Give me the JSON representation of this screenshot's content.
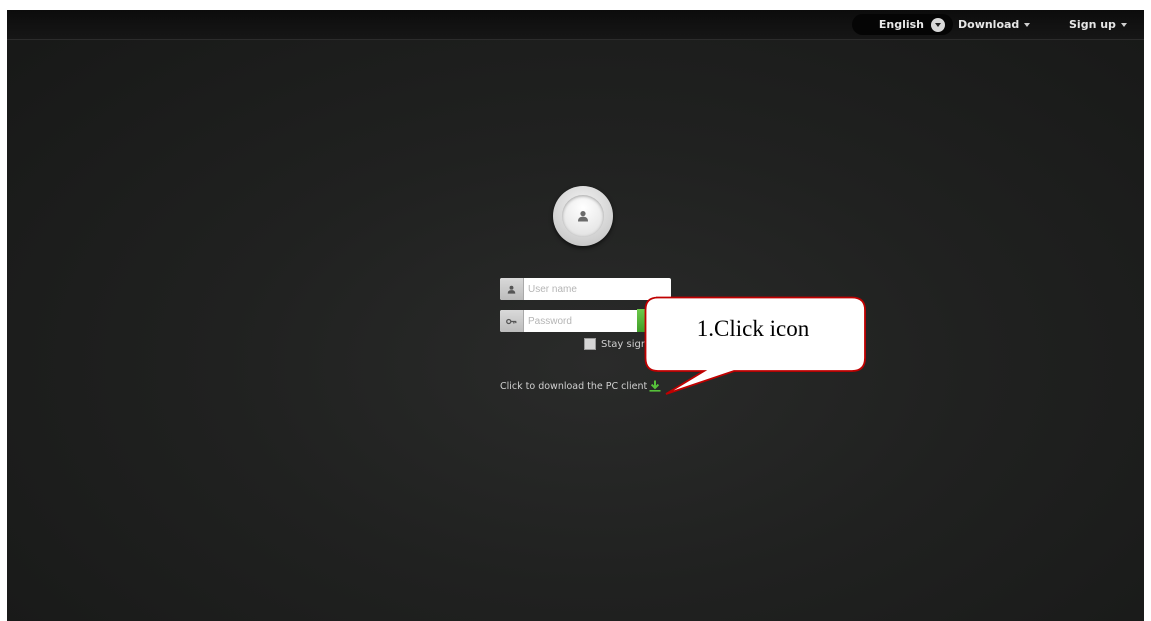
{
  "topbar": {
    "language": "English",
    "download": "Download",
    "signup": "Sign up"
  },
  "login": {
    "avatar_icon": "user-icon",
    "username_placeholder": "User name",
    "password_placeholder": "Password",
    "stay_signed_in": "Stay signed in",
    "download_text": "Click to download the PC client"
  },
  "callout": {
    "text": "1.Click icon"
  },
  "colors": {
    "accent_green": "#4caf2e",
    "callout_border": "#c00000",
    "background": "#1e1f1e"
  }
}
